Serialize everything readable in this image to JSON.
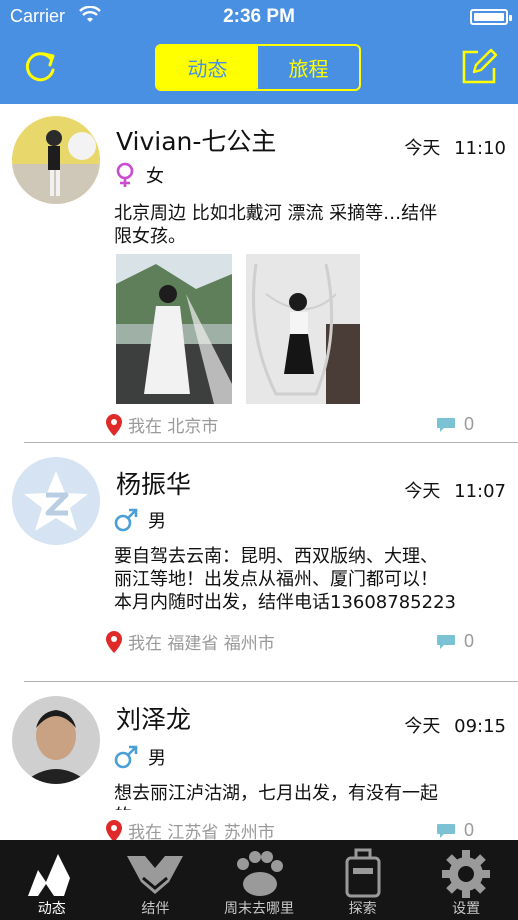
{
  "status_bar": {
    "carrier": "Carrier",
    "time": "2:36 PM",
    "battery_level": 1.0
  },
  "nav": {
    "refresh_icon": "refresh-icon",
    "segments": [
      {
        "label": "动态",
        "active": true
      },
      {
        "label": "旅程",
        "active": false
      }
    ],
    "compose_icon": "compose-icon",
    "accent": "#ffff00",
    "bar_color": "#4a90e2"
  },
  "posts": [
    {
      "name": "Vivian-七公主",
      "gender_symbol": "♀",
      "gender": "女",
      "date": "今天",
      "time": "11:10",
      "content_line1": "北京周边 比如北戴河 漂流 采摘等…结伴",
      "content_line2": "限女孩。",
      "location": "我在 北京市",
      "comments": "0"
    },
    {
      "name": "杨振华",
      "gender_symbol": "♂",
      "gender": "男",
      "date": "今天",
      "time": "11:07",
      "content_line1": "要自驾去云南：昆明、西双版纳、大理、",
      "content_line2": "丽江等地！出发点从福州、厦门都可以！",
      "content_line3": "本月内随时出发，结伴电话13608785223",
      "location": "我在 福建省 福州市",
      "comments": "0"
    },
    {
      "name": "刘泽龙",
      "gender_symbol": "♂",
      "gender": "男",
      "date": "今天",
      "time": "09:15",
      "content_line1": "想去丽江泸沽湖，七月出发，有没有一起",
      "content_line2": "的",
      "location": "我在 江苏省 苏州市",
      "comments": "0"
    }
  ],
  "tabs": [
    {
      "label": "动态",
      "icon": "dynamic-icon",
      "active": true
    },
    {
      "label": "结伴",
      "icon": "handshake-icon",
      "active": false
    },
    {
      "label": "周末去哪里",
      "icon": "paw-icon",
      "active": false
    },
    {
      "label": "探索",
      "icon": "luggage-icon",
      "active": false
    },
    {
      "label": "设置",
      "icon": "gear-icon",
      "active": false
    }
  ]
}
